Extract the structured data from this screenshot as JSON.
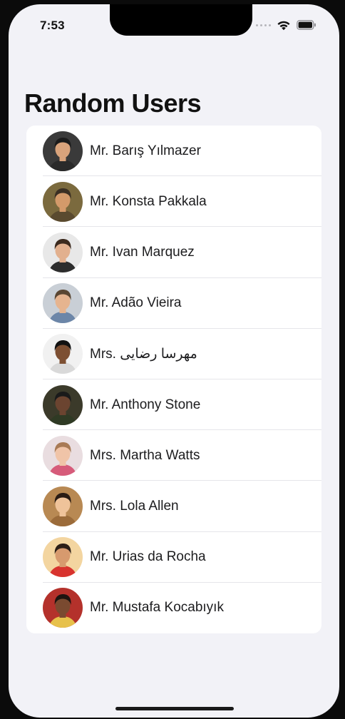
{
  "status_bar": {
    "time": "7:53",
    "icons": [
      "cellular-dots-icon",
      "wifi-icon",
      "battery-icon"
    ]
  },
  "title": "Random Users",
  "users": [
    {
      "name": "Mr. Barış Yılmazer",
      "avatar": {
        "bg": "#3a3a3a",
        "skin": "#d9a37b",
        "hair": "#1b1b1b",
        "shirt": "#2a2a2a"
      }
    },
    {
      "name": "Mr. Konsta Pakkala",
      "avatar": {
        "bg": "#7b6a3e",
        "skin": "#d49a6a",
        "hair": "#3b2f23",
        "shirt": "#5a4a2f"
      }
    },
    {
      "name": "Mr. Ivan Marquez",
      "avatar": {
        "bg": "#e8e8e8",
        "skin": "#e2b08e",
        "hair": "#3c2a1e",
        "shirt": "#2d2d2d"
      }
    },
    {
      "name": "Mr. Adão Vieira",
      "avatar": {
        "bg": "#c9cfd6",
        "skin": "#e6b48f",
        "hair": "#5a4632",
        "shirt": "#6c86a8"
      }
    },
    {
      "name": "Mrs. مهرسا رضایی",
      "avatar": {
        "bg": "#f1f1f1",
        "skin": "#7d4f32",
        "hair": "#121212",
        "shirt": "#d9d9d9"
      }
    },
    {
      "name": "Mr. Anthony Stone",
      "avatar": {
        "bg": "#3b3a2a",
        "skin": "#6b4430",
        "hair": "#1a1a1a",
        "shirt": "#2f3a24"
      }
    },
    {
      "name": "Mrs. Martha Watts",
      "avatar": {
        "bg": "#e9dde0",
        "skin": "#f0c4a8",
        "hair": "#a87a55",
        "shirt": "#d65b7a"
      }
    },
    {
      "name": "Mrs. Lola Allen",
      "avatar": {
        "bg": "#b88953",
        "skin": "#efc39a",
        "hair": "#2a1c14",
        "shirt": "#9b6b3a"
      }
    },
    {
      "name": "Mr. Urias da Rocha",
      "avatar": {
        "bg": "#f3d5a0",
        "skin": "#d79a6e",
        "hair": "#2c1e16",
        "shirt": "#d8332e"
      }
    },
    {
      "name": "Mr. Mustafa Kocabıyık",
      "avatar": {
        "bg": "#b4312b",
        "skin": "#7a4a30",
        "hair": "#1d1410",
        "shirt": "#e7c14b"
      }
    }
  ]
}
